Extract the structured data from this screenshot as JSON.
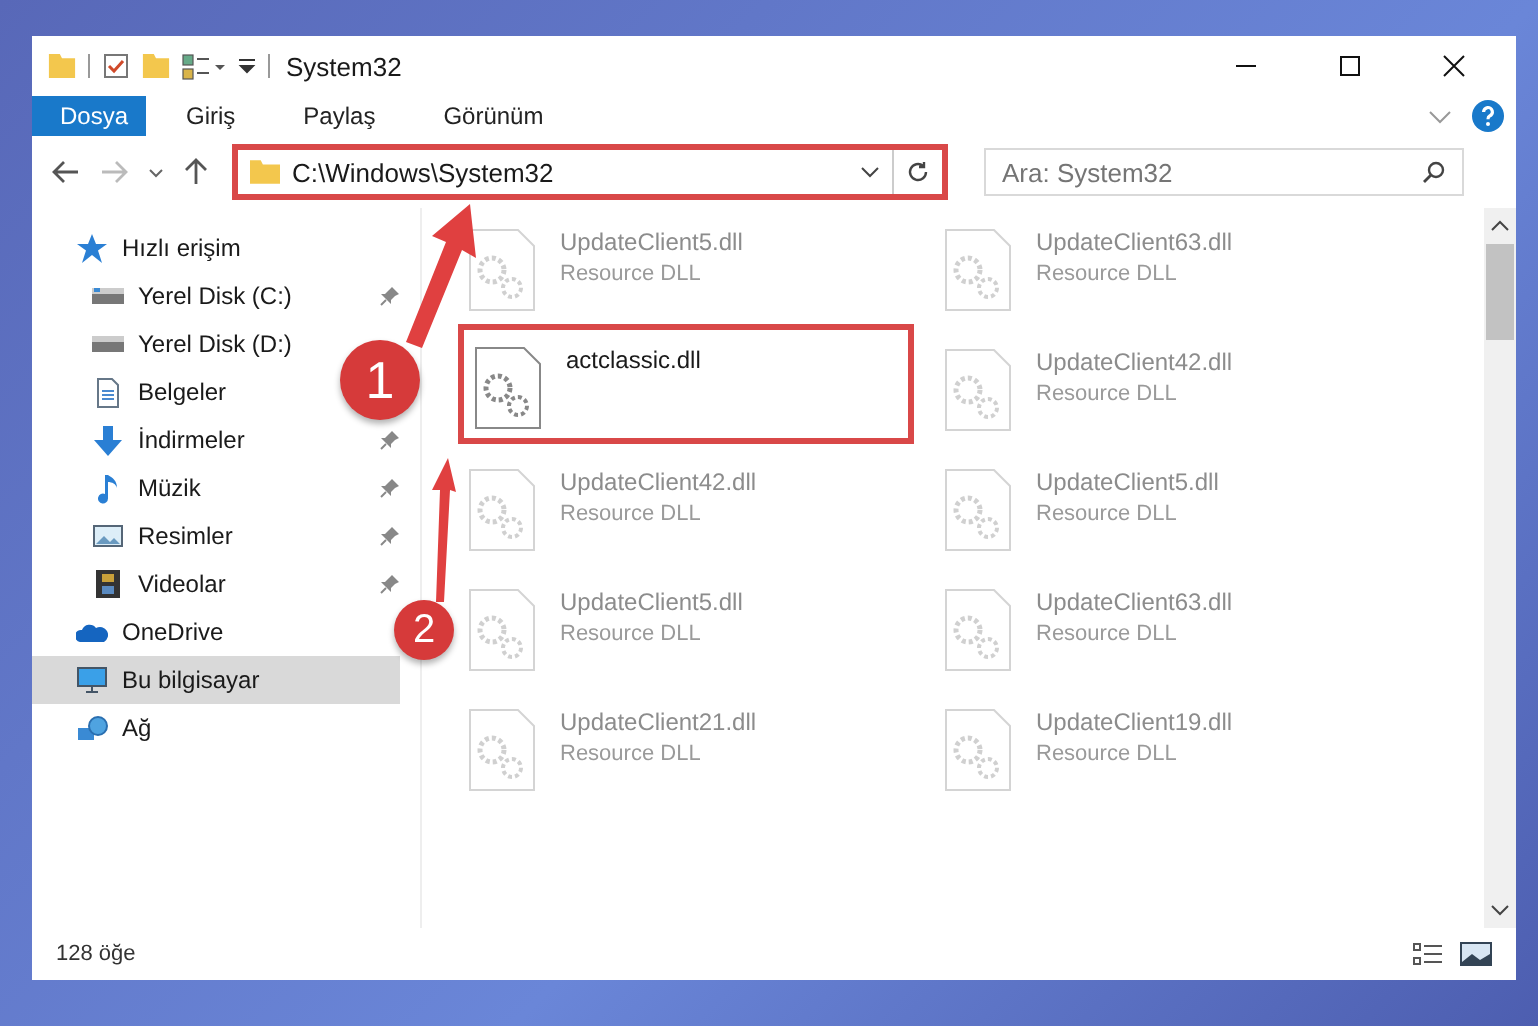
{
  "window": {
    "title": "System32"
  },
  "ribbon_tabs": [
    {
      "label": "Dosya",
      "selected": true
    },
    {
      "label": "Giriş",
      "selected": false
    },
    {
      "label": "Paylaş",
      "selected": false
    },
    {
      "label": "Görünüm",
      "selected": false
    }
  ],
  "address_bar": {
    "path": "C:\\Windows\\System32",
    "highlighted": true
  },
  "search": {
    "placeholder": "Ara: System32"
  },
  "sidebar": {
    "items": [
      {
        "label": "Hızlı erişim",
        "selected": false,
        "children": [
          {
            "label": "Yerel Disk (C:)",
            "pinned": true,
            "selected": false
          },
          {
            "label": "Yerel Disk (D:)",
            "pinned": false,
            "selected": false
          },
          {
            "label": "Belgeler",
            "pinned": false,
            "selected": false
          },
          {
            "label": "İndirmeler",
            "pinned": true,
            "selected": false
          },
          {
            "label": "Müzik",
            "pinned": true,
            "selected": false
          },
          {
            "label": "Resimler",
            "pinned": true,
            "selected": false
          },
          {
            "label": "Videolar",
            "pinned": true,
            "selected": false
          }
        ]
      },
      {
        "label": "OneDrive",
        "selected": false
      },
      {
        "label": "Bu bilgisayar",
        "selected": true
      },
      {
        "label": "Ağ",
        "selected": false
      }
    ]
  },
  "files": [
    {
      "name": "UpdateClient5.dll",
      "type": "Resource DLL",
      "highlighted": false
    },
    {
      "name": "UpdateClient63.dll",
      "type": "Resource DLL",
      "highlighted": false
    },
    {
      "name": "actclassic.dll",
      "highlighted": true
    },
    {
      "name": "UpdateClient42.dll",
      "type": "Resource DLL",
      "highlighted": false
    },
    {
      "name": "UpdateClient42.dll",
      "type": "Resource DLL",
      "highlighted": false
    },
    {
      "name": "UpdateClient5.dll",
      "type": "Resource DLL",
      "highlighted": false
    },
    {
      "name": "UpdateClient5.dll",
      "type": "Resource DLL",
      "highlighted": false
    },
    {
      "name": "UpdateClient63.dll",
      "type": "Resource DLL",
      "highlighted": false
    },
    {
      "name": "UpdateClient21.dll",
      "type": "Resource DLL",
      "highlighted": false
    },
    {
      "name": "UpdateClient19.dll",
      "type": "Resource DLL",
      "highlighted": false
    }
  ],
  "status_bar": {
    "item_count": "128 öğe"
  },
  "annotations": [
    {
      "number": "1"
    },
    {
      "number": "2"
    }
  ]
}
